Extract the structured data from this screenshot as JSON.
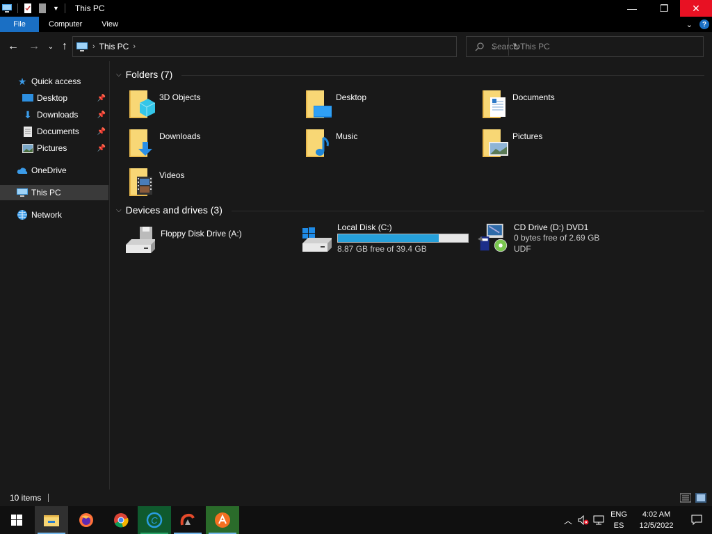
{
  "window": {
    "title": "This PC",
    "controls": {
      "minimize": "—",
      "maximize": "❐",
      "close": "✕"
    }
  },
  "ribbon": {
    "tabs": [
      "File",
      "Computer",
      "View"
    ]
  },
  "address": {
    "crumb": "This PC",
    "search_placeholder": "Search This PC"
  },
  "nav": {
    "quick_access": "Quick access",
    "pinned": [
      "Desktop",
      "Downloads",
      "Documents",
      "Pictures"
    ],
    "onedrive": "OneDrive",
    "this_pc": "This PC",
    "network": "Network"
  },
  "content": {
    "folders_header": "Folders (7)",
    "folders": [
      "3D Objects",
      "Desktop",
      "Documents",
      "Downloads",
      "Music",
      "Pictures",
      "Videos"
    ],
    "devices_header": "Devices and drives (3)",
    "drives": [
      {
        "name": "Floppy Disk Drive (A:)"
      },
      {
        "name": "Local Disk (C:)",
        "free": "8.87 GB free of 39.4 GB",
        "used_fraction": 0.775
      },
      {
        "name": "CD Drive (D:) DVD1",
        "free": "0 bytes free of 2.69 GB",
        "fs": "UDF"
      }
    ]
  },
  "status": {
    "count": "10 items"
  },
  "taskbar": {
    "lang_top": "ENG",
    "lang_bottom": "ES",
    "time": "4:02 AM",
    "date": "12/5/2022"
  },
  "colors": {
    "accent": "#1a6fc4",
    "close_red": "#e81123",
    "progress": "#26a0da",
    "folder": "#f8d775"
  }
}
